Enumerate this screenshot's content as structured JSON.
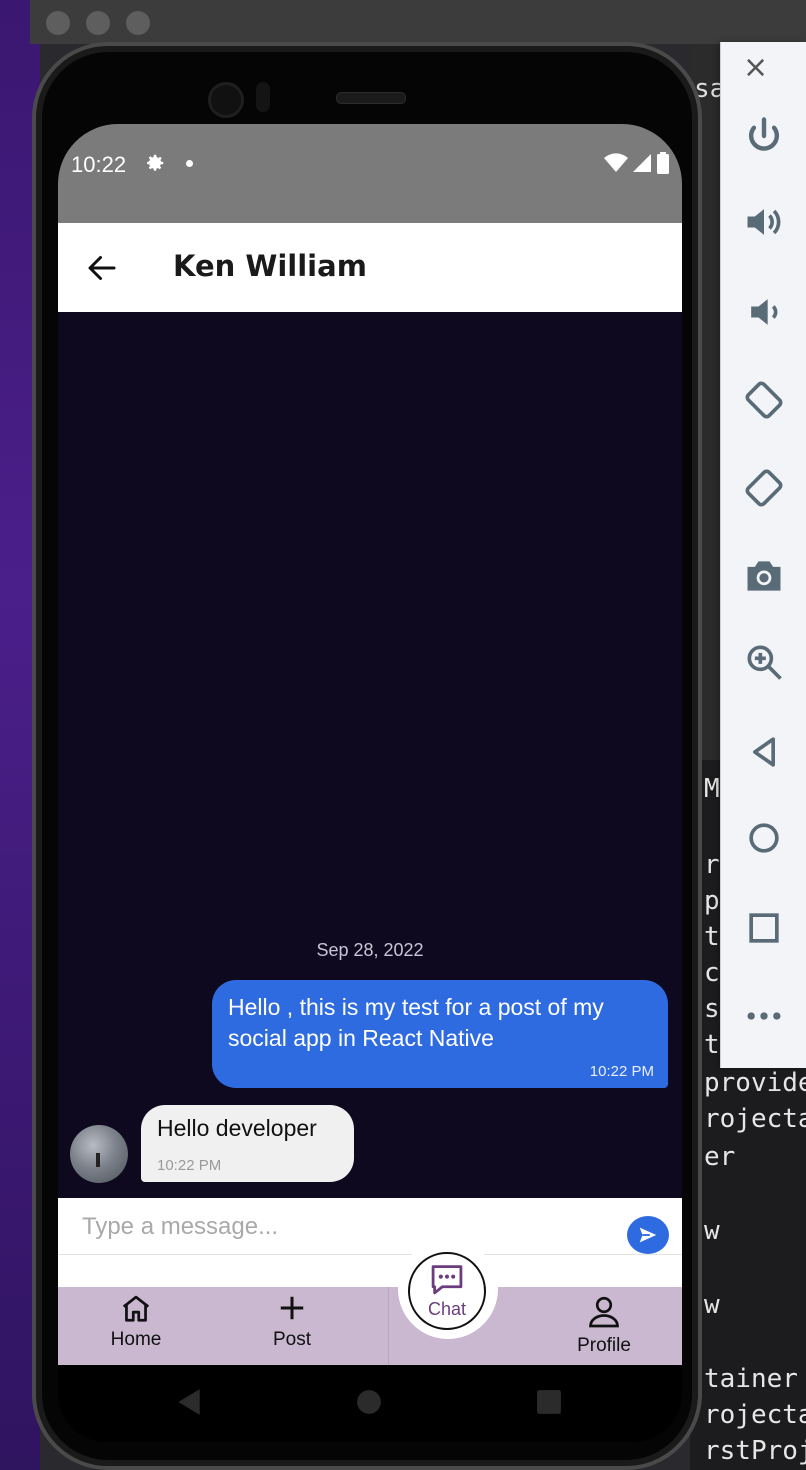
{
  "status_bar": {
    "time": "10:22"
  },
  "header": {
    "title": "Ken William"
  },
  "chat": {
    "date_separator": "Sep 28, 2022",
    "messages": [
      {
        "direction": "out",
        "text": "Hello , this is my test for a post of my social app in React Native",
        "time": "10:22 PM"
      },
      {
        "direction": "in",
        "text": "Hello developer",
        "time": "10:22 PM"
      }
    ]
  },
  "composer": {
    "placeholder": "Type a message...",
    "value": ""
  },
  "tabs": {
    "home": "Home",
    "post": "Post",
    "chat": "Chat",
    "profile": "Profile"
  },
  "terminal": {
    "lines": [
      "provider",
      "rojecta",
      "er",
      "w",
      "w",
      "tainer",
      "rojecta",
      "rstProje"
    ],
    "side_chars": [
      "r",
      "p",
      "t",
      "c",
      "s",
      "t",
      "M"
    ]
  },
  "colors": {
    "chat_bg": "#0f0920",
    "outgoing_bubble": "#2f6be0",
    "tabbar": "#c9b8d0",
    "accent_purple": "#6b3d7e"
  }
}
